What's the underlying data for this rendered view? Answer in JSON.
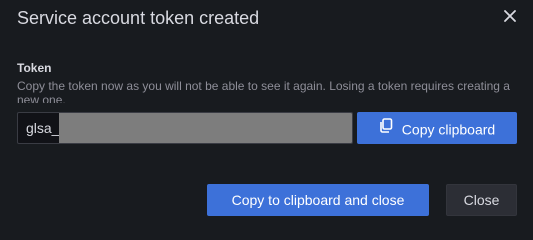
{
  "dialog": {
    "title": "Service account token created",
    "close_icon": "close-icon"
  },
  "token_field": {
    "label": "Token",
    "description": "Copy the token now as you will not be able to see it again. Losing a token requires creating a new one.",
    "value_prefix": "glsa_"
  },
  "buttons": {
    "copy_clipboard": "Copy clipboard",
    "copy_icon": "copy-icon",
    "copy_and_close": "Copy to clipboard and close",
    "close": "Close"
  },
  "colors": {
    "background": "#181b1f",
    "primary": "#3d71d9",
    "secondary": "#2c2e35"
  }
}
